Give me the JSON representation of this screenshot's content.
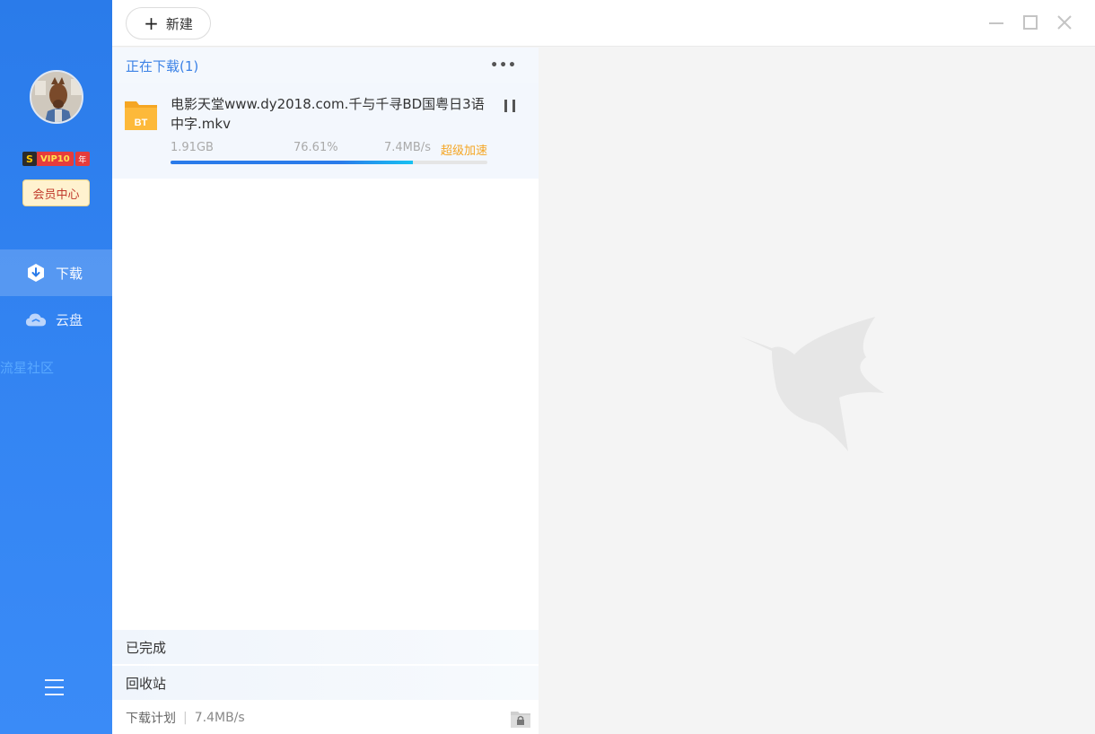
{
  "sidebar": {
    "vip": {
      "s": "S",
      "label": "VIP10",
      "year": "年"
    },
    "member_center": "会员中心",
    "nav": [
      {
        "label": "下载",
        "icon": "download-icon",
        "active": true
      },
      {
        "label": "云盘",
        "icon": "cloud-icon",
        "active": false
      }
    ],
    "community": "流星社区",
    "menu_icon": "hamburger-icon"
  },
  "topbar": {
    "new_label": "新建",
    "window_controls": [
      "minimize-icon",
      "maximize-icon",
      "close-icon"
    ]
  },
  "downloading": {
    "header": "正在下载(1)",
    "tasks": [
      {
        "type_badge": "BT",
        "name": "电影天堂www.dy2018.com.千与千寻BD国粤日3语中字.mkv",
        "size": "1.91GB",
        "percent": "76.61%",
        "progress": 0.7661,
        "speed": "7.4MB/s",
        "accel": "超级加速"
      }
    ]
  },
  "sections": {
    "completed": "已完成",
    "recycle": "回收站"
  },
  "footer": {
    "plan": "下载计划",
    "speed": "7.4MB/s"
  },
  "colors": {
    "accent": "#2a7bea",
    "accel": "#f5a623"
  }
}
